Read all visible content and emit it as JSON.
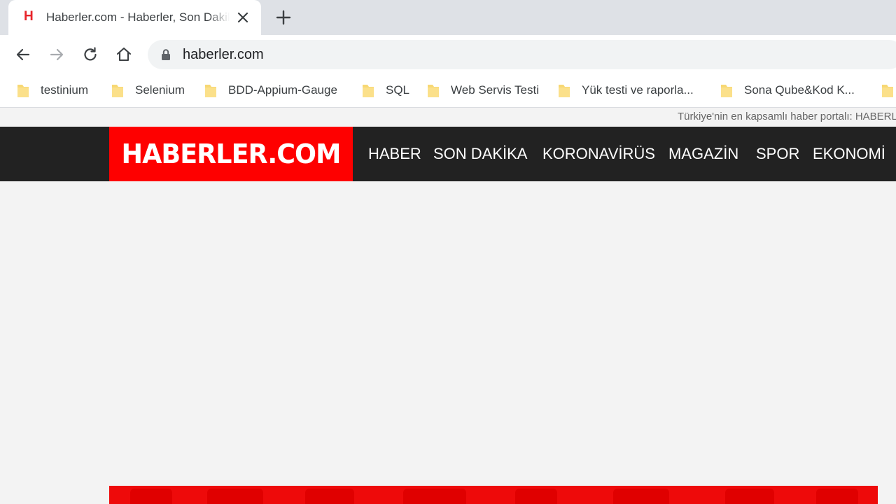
{
  "browser": {
    "tab": {
      "favicon": "H",
      "title": "Haberler.com - Haberler, Son Dakika Haberleri"
    },
    "url": "haberler.com",
    "bookmarks": [
      "testinium",
      "Selenium",
      "BDD-Appium-Gauge",
      "SQL",
      "Web Servis Testi",
      "Yük testi ve raporla...",
      "Sona Qube&Kod K..."
    ],
    "colors": {
      "tabstrip": "#dee1e6",
      "folder": "#f7d874"
    }
  },
  "page": {
    "tagline": "Türkiye'nin en kapsamlı haber portalı: HABERLER.COM",
    "logo": "HABERLER.COM",
    "menu": [
      "HABER",
      "SON DAKİKA",
      "KORONAVİRÜS",
      "MAGAZİN",
      "SPOR",
      "EKONOMİ"
    ],
    "colors": {
      "brand_red": "#fe0000",
      "nav_bg": "#222222",
      "page_bg": "#f3f3f3"
    }
  }
}
